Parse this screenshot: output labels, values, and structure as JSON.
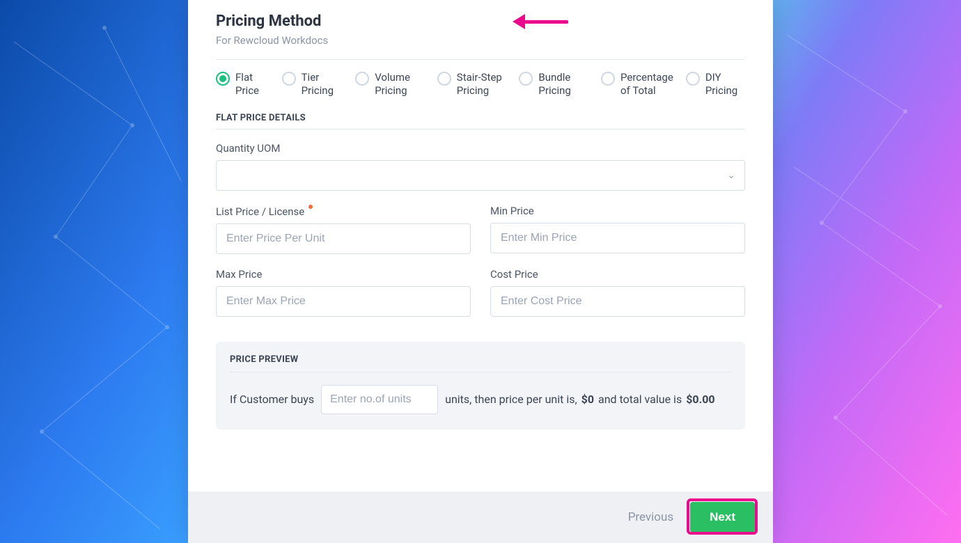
{
  "header": {
    "title": "Pricing Method",
    "subtitle": "For Rewcloud Workdocs"
  },
  "radios": {
    "options": [
      {
        "label": "Flat Price",
        "selected": true
      },
      {
        "label": "Tier Pricing",
        "selected": false
      },
      {
        "label": "Volume Pricing",
        "selected": false
      },
      {
        "label": "Stair-Step Pricing",
        "selected": false
      },
      {
        "label": "Bundle Pricing",
        "selected": false
      },
      {
        "label": "Percentage of Total",
        "selected": false
      },
      {
        "label": "DIY Pricing",
        "selected": false
      }
    ]
  },
  "details": {
    "section_label": "FLAT PRICE DETAILS",
    "uom_label": "Quantity UOM",
    "list_price_label": "List Price / License",
    "list_price_placeholder": "Enter Price Per Unit",
    "min_price_label": "Min Price",
    "min_price_placeholder": "Enter Min Price",
    "max_price_label": "Max Price",
    "max_price_placeholder": "Enter Max Price",
    "cost_price_label": "Cost Price",
    "cost_price_placeholder": "Enter Cost Price"
  },
  "preview": {
    "title": "PRICE PREVIEW",
    "text_before": "If Customer buys",
    "units_placeholder": "Enter no.of units",
    "text_mid1": "units, then price per unit is,",
    "per_unit_value": "$0",
    "text_mid2": "and total value is",
    "total_value": "$0.00"
  },
  "footer": {
    "previous": "Previous",
    "next": "Next"
  },
  "colors": {
    "accent_green": "#17c27d",
    "button_green": "#2bbf63",
    "annotation_pink": "#ec0a8c"
  }
}
